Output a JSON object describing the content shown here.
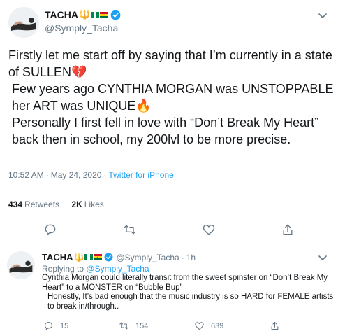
{
  "main_tweet": {
    "display_name": "TACHA",
    "handle": "@Symply_Tacha",
    "paragraphs": [
      "Firstly let me start off by saying that I’m currently in a state of SULLEN💔",
      "Few years ago CYNTHIA MORGAN was UNSTOPPABLE her ART was UNIQUE🔥",
      "Personally I first fell in love with “Don’t Break My Heart” back then in school, my 200lvl to be more precise."
    ],
    "time": "10:52 AM",
    "date": "May 24, 2020",
    "source": "Twitter for iPhone",
    "retweets_count": "434",
    "retweets_label": "Retweets",
    "likes_count": "2K",
    "likes_label": "Likes"
  },
  "reply_tweet": {
    "display_name": "TACHA",
    "handle": "@Symply_Tacha",
    "age": "1h",
    "replying_label": "Replying to",
    "replying_to": "@Symply_Tacha",
    "paragraphs": [
      "Cynthia Morgan could literally transit from the sweet spinster on “Don’t Break My Heart” to a MONSTER on “Bubble Bup”",
      "Honestly, It’s bad enough that the music industry is so HARD for FEMALE artists to break in/through.."
    ],
    "reply_count": "15",
    "retweet_count": "154",
    "like_count": "639"
  },
  "name_emoji": "🔱",
  "colors": {
    "accent": "#1da1f2",
    "muted": "#657786",
    "text": "#14171a",
    "border": "#e6ecf0"
  },
  "icons": [
    "caret-down-icon",
    "verified-badge-icon",
    "reply-icon",
    "retweet-icon",
    "like-icon",
    "share-icon",
    "nigeria-flag-icon",
    "ghana-flag-icon"
  ]
}
